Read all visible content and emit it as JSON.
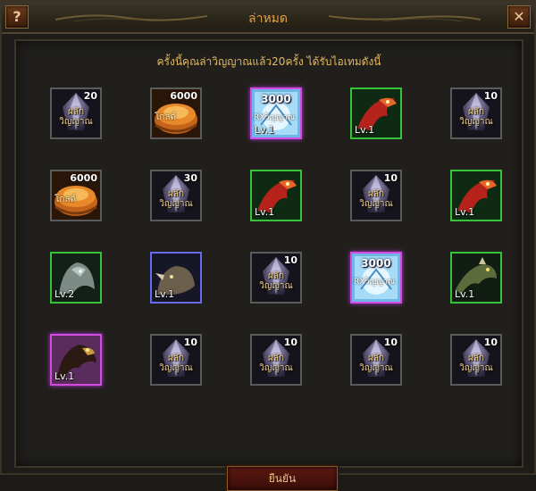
{
  "dialog": {
    "title": "ล่าหมด",
    "help_glyph": "?",
    "close_glyph": "✕",
    "subtitle": "ครั้งนี้คุณล่าวิญญาณแล้ว20ครั้ง ได้รับไอเทมดังนี้",
    "confirm_label": "ยืนยัน"
  },
  "colors": {
    "title_gold": "#e0a24a",
    "subtitle_gold": "#e6b95c",
    "frame_green": "#37c23b",
    "frame_purple": "#d44be3",
    "frame_blue": "#6a6af0",
    "button_red": "#5c1912"
  },
  "rewards": [
    {
      "kind": "soul",
      "frame": "frame-gray",
      "qty": "20",
      "label": "ผลึก วิญญาณ"
    },
    {
      "kind": "gold",
      "frame": "frame-gray",
      "qty": "6000",
      "label": "โกลด์"
    },
    {
      "kind": "card",
      "frame": "frame-purple",
      "qty": "3000",
      "label": "RXวิญญาณ",
      "level": "Lv.1"
    },
    {
      "kind": "bird",
      "frame": "frame-green",
      "level": "Lv.1"
    },
    {
      "kind": "soul",
      "frame": "frame-gray",
      "qty": "10",
      "label": "ผลึก วิญญาณ"
    },
    {
      "kind": "gold",
      "frame": "frame-gray",
      "qty": "6000",
      "label": "โกลด์"
    },
    {
      "kind": "soul",
      "frame": "frame-gray",
      "qty": "30",
      "label": "ผลึก วิญญาณ"
    },
    {
      "kind": "bird",
      "frame": "frame-green",
      "level": "Lv.1"
    },
    {
      "kind": "soul",
      "frame": "frame-gray",
      "qty": "10",
      "label": "ผลึก วิญญาณ"
    },
    {
      "kind": "bird",
      "frame": "frame-green",
      "level": "Lv.1"
    },
    {
      "kind": "wolf",
      "frame": "frame-green",
      "level": "Lv.2"
    },
    {
      "kind": "rhino",
      "frame": "frame-blue",
      "level": "Lv.1"
    },
    {
      "kind": "soul",
      "frame": "frame-gray",
      "qty": "10",
      "label": "ผลึก วิญญาณ"
    },
    {
      "kind": "card",
      "frame": "frame-purple",
      "qty": "3000",
      "label": "RXวิญญาณ"
    },
    {
      "kind": "dragon",
      "frame": "frame-green",
      "level": "Lv.1"
    },
    {
      "kind": "eagle",
      "frame": "frame-purple",
      "level": "Lv.1"
    },
    {
      "kind": "soul",
      "frame": "frame-gray",
      "qty": "10",
      "label": "ผลึก วิญญาณ"
    },
    {
      "kind": "soul",
      "frame": "frame-gray",
      "qty": "10",
      "label": "ผลึก วิญญาณ"
    },
    {
      "kind": "soul",
      "frame": "frame-gray",
      "qty": "10",
      "label": "ผลึก วิญญาณ"
    },
    {
      "kind": "soul",
      "frame": "frame-gray",
      "qty": "10",
      "label": "ผลึก วิญญาณ"
    }
  ]
}
